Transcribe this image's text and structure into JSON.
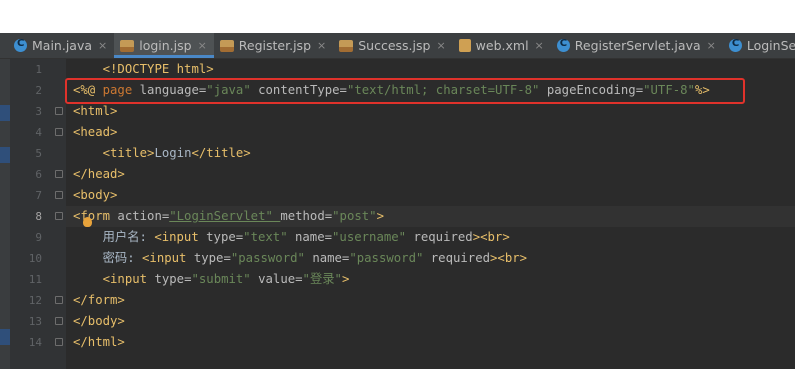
{
  "tabs": [
    {
      "label": "Main.java",
      "icon": "java-class-icon",
      "active": false
    },
    {
      "label": "login.jsp",
      "icon": "jsp-file-icon",
      "active": true
    },
    {
      "label": "Register.jsp",
      "icon": "jsp-file-icon",
      "active": false
    },
    {
      "label": "Success.jsp",
      "icon": "jsp-file-icon",
      "active": false
    },
    {
      "label": "web.xml",
      "icon": "xml-file-icon",
      "active": false
    },
    {
      "label": "RegisterServlet.java",
      "icon": "java-class-icon",
      "active": false
    },
    {
      "label": "LoginServlet.java",
      "icon": "java-class-icon",
      "active": false
    }
  ],
  "tab_close_glyph": "×",
  "editor": {
    "current_line": 8,
    "line_numbers": [
      "1",
      "2",
      "3",
      "4",
      "5",
      "6",
      "7",
      "8",
      "9",
      "10",
      "11",
      "12",
      "13",
      "14"
    ],
    "lines": [
      {
        "num": "1",
        "tokens": [
          [
            "plain",
            "    "
          ],
          [
            "tag",
            "<!DOCTYPE html>"
          ]
        ]
      },
      {
        "num": "2",
        "tokens": [
          [
            "tag",
            "<%@ "
          ],
          [
            "jspd",
            "page "
          ],
          [
            "attr",
            "language="
          ],
          [
            "val",
            "\"java\" "
          ],
          [
            "attr",
            "contentType="
          ],
          [
            "val",
            "\"text/html; charset=UTF-8\" "
          ],
          [
            "attr",
            "pageEncoding="
          ],
          [
            "val",
            "\"UTF-8\""
          ],
          [
            "tag",
            "%>"
          ]
        ]
      },
      {
        "num": "3",
        "tokens": [
          [
            "tag",
            "<html>"
          ]
        ]
      },
      {
        "num": "4",
        "tokens": [
          [
            "tag",
            "<head>"
          ]
        ]
      },
      {
        "num": "5",
        "tokens": [
          [
            "plain",
            "    "
          ],
          [
            "tag",
            "<title>"
          ],
          [
            "cn",
            "Login"
          ],
          [
            "tag",
            "</title>"
          ]
        ]
      },
      {
        "num": "6",
        "tokens": [
          [
            "tag",
            "</head>"
          ]
        ]
      },
      {
        "num": "7",
        "tokens": [
          [
            "tag",
            "<body>"
          ]
        ]
      },
      {
        "num": "8",
        "tokens": [
          [
            "tag",
            "<form "
          ],
          [
            "attr",
            "action="
          ],
          [
            "val",
            "\"LoginServlet\" "
          ],
          [
            "attr",
            "method="
          ],
          [
            "val",
            "\"post\""
          ],
          [
            "tag",
            ">"
          ]
        ]
      },
      {
        "num": "9",
        "tokens": [
          [
            "plain",
            "    用户名: "
          ],
          [
            "tag",
            "<input "
          ],
          [
            "attr",
            "type="
          ],
          [
            "val",
            "\"text\" "
          ],
          [
            "attr",
            "name="
          ],
          [
            "val",
            "\"username\" "
          ],
          [
            "attr",
            "required"
          ],
          [
            "tag",
            "><br>"
          ]
        ]
      },
      {
        "num": "10",
        "tokens": [
          [
            "plain",
            "    密码: "
          ],
          [
            "tag",
            "<input "
          ],
          [
            "attr",
            "type="
          ],
          [
            "val",
            "\"password\" "
          ],
          [
            "attr",
            "name="
          ],
          [
            "val",
            "\"password\" "
          ],
          [
            "attr",
            "required"
          ],
          [
            "tag",
            "><br>"
          ]
        ]
      },
      {
        "num": "11",
        "tokens": [
          [
            "plain",
            "    "
          ],
          [
            "tag",
            "<input "
          ],
          [
            "attr",
            "type="
          ],
          [
            "val",
            "\"submit\" "
          ],
          [
            "attr",
            "value="
          ],
          [
            "val",
            "\"登录\""
          ],
          [
            "tag",
            ">"
          ]
        ]
      },
      {
        "num": "12",
        "tokens": [
          [
            "tag",
            "</form>"
          ]
        ]
      },
      {
        "num": "13",
        "tokens": [
          [
            "tag",
            "</body>"
          ]
        ]
      },
      {
        "num": "14",
        "tokens": [
          [
            "tag",
            "</html>"
          ]
        ]
      }
    ]
  },
  "annotation": {
    "color": "#e0322b",
    "target_line": 2
  }
}
